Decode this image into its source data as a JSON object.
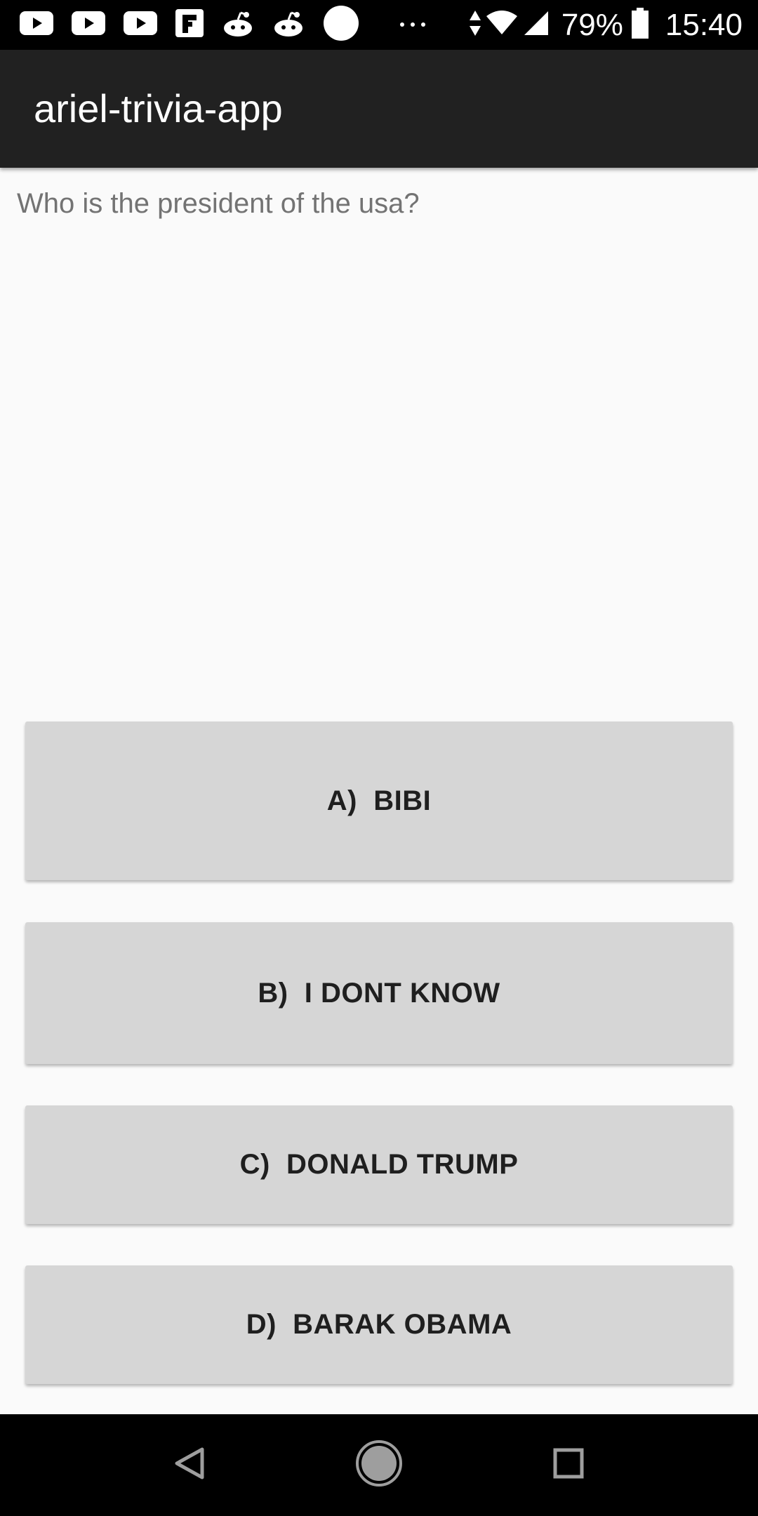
{
  "status_bar": {
    "notification_icons": [
      "youtube-icon",
      "youtube-icon",
      "youtube-icon",
      "flipboard-icon",
      "reddit-icon",
      "reddit-icon",
      "circle-icon",
      "more-dots-icon"
    ],
    "battery_percent": "79%",
    "time": "15:40"
  },
  "app_bar": {
    "title": "ariel-trivia-app"
  },
  "question": {
    "text": "Who is the president of the usa?"
  },
  "answers": [
    {
      "label": "A)  BIBI"
    },
    {
      "label": "B)  I DONT KNOW"
    },
    {
      "label": "C)  DONALD TRUMP"
    },
    {
      "label": "D)  BARAK OBAMA"
    }
  ],
  "nav_bar": {
    "icons": [
      "back-icon",
      "home-icon",
      "recents-icon"
    ]
  },
  "colors": {
    "app_bar_bg": "#212121",
    "page_bg": "#fafafa",
    "button_bg": "#d6d6d6",
    "status_bar_bg": "#000000"
  }
}
